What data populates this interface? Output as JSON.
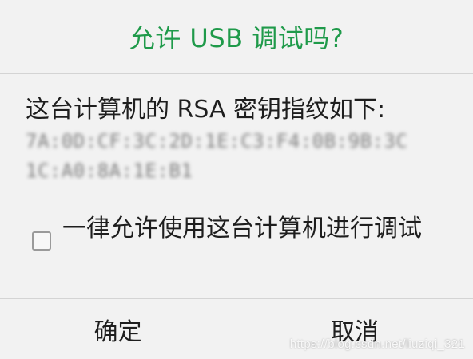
{
  "dialog": {
    "title": "允许 USB 调试吗?",
    "message": "这台计算机的 RSA 密钥指纹如下:",
    "fingerprint": {
      "line1": "7A:0D:CF:3C:2D:1E:C3:F4:0B:9B:3C",
      "line2": "1C:A0:8A:1E:B1"
    },
    "checkbox": {
      "label": "一律允许使用这台计算机进行调试",
      "checked": false
    },
    "buttons": {
      "ok": "确定",
      "cancel": "取消"
    }
  },
  "watermark": "https://blog.csdn.net/liuziqi_321",
  "colors": {
    "title": "#1f9a4a",
    "background": "#f2f2f2",
    "divider": "#d4d4d4",
    "text": "#1e1e1e"
  }
}
